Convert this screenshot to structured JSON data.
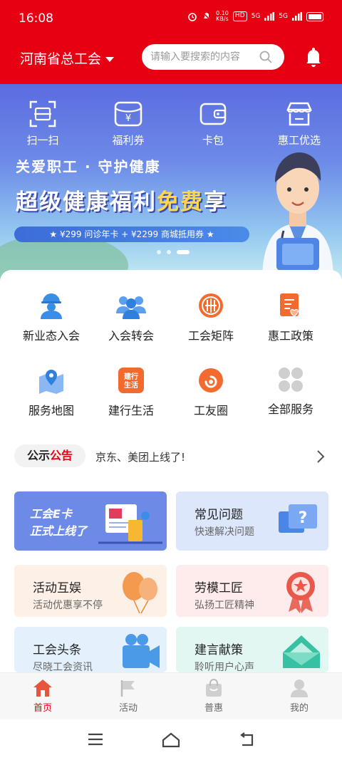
{
  "status_bar": {
    "time": "16:08",
    "net_speed": "0.10\nKB/s",
    "hd": "HD",
    "sig1": "5G",
    "sig2": "5G"
  },
  "header": {
    "region": "河南省总工会",
    "search_placeholder": "请输入要搜索的内容"
  },
  "banner": {
    "quick_actions": [
      {
        "label": "扫一扫",
        "icon": "scan-icon"
      },
      {
        "label": "福利券",
        "icon": "coupon-icon"
      },
      {
        "label": "卡包",
        "icon": "wallet-icon"
      },
      {
        "label": "惠工优选",
        "icon": "shop-icon"
      }
    ],
    "slogan": "关爱职工 · 守护健康",
    "headline_pre": "超级健康福利",
    "headline_hl": "免费",
    "headline_post": "享",
    "ribbon": "★ ¥299 问诊年卡 + ¥2299 商城抵用券 ★"
  },
  "services": [
    {
      "label": "新业态入会",
      "icon": "worker-icon"
    },
    {
      "label": "入会转会",
      "icon": "members-icon"
    },
    {
      "label": "工会矩阵",
      "icon": "union-matrix-icon"
    },
    {
      "label": "惠工政策",
      "icon": "policy-icon"
    },
    {
      "label": "服务地图",
      "icon": "map-icon"
    },
    {
      "label": "建行生活",
      "icon": "ccb-life-icon",
      "icon_text": "建行\n生活"
    },
    {
      "label": "工友圈",
      "icon": "circle-icon"
    },
    {
      "label": "全部服务",
      "icon": "all-services-icon"
    }
  ],
  "notice": {
    "tag_a": "公示",
    "tag_b": "公告",
    "text": "京东、美团上线了!"
  },
  "tiles": [
    {
      "title": "工会E卡",
      "subtitle": "正式上线了",
      "bg": "#6d8be6"
    },
    {
      "title": "常见问题",
      "subtitle": "快速解决问题",
      "bg": "#dde7fb"
    },
    {
      "title": "活动互娱",
      "subtitle": "活动优惠享不停",
      "bg": "#fdf0e6"
    },
    {
      "title": "劳模工匠",
      "subtitle": "弘扬工匠精神",
      "bg": "#fdeceb"
    },
    {
      "title": "工会头条",
      "subtitle": "尽晓工会资讯",
      "bg": "#e4f1fc"
    },
    {
      "title": "建言献策",
      "subtitle": "聆听用户心声",
      "bg": "#e2f6f2"
    }
  ],
  "tabbar": [
    {
      "label": "首页",
      "icon": "home-icon",
      "active": true
    },
    {
      "label": "活动",
      "icon": "flag-icon"
    },
    {
      "label": "普惠",
      "icon": "bag-icon"
    },
    {
      "label": "我的",
      "icon": "user-icon"
    }
  ],
  "colors": {
    "brand_red": "#e60012",
    "icon_blue": "#3a8ee6",
    "icon_orange": "#f26a2e"
  }
}
